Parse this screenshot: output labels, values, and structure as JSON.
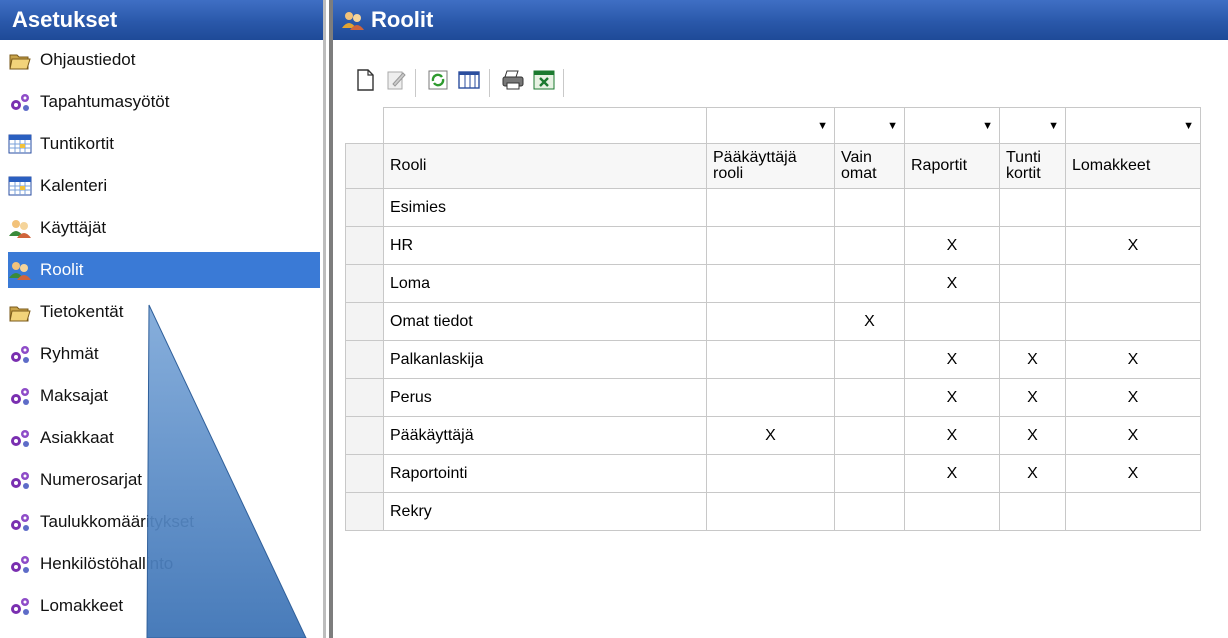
{
  "sidebar": {
    "title": "Asetukset",
    "items": [
      {
        "label": "Ohjaustiedot",
        "icon": "folder-icon"
      },
      {
        "label": "Tapahtumasyötöt",
        "icon": "gears-icon"
      },
      {
        "label": "Tuntikortit",
        "icon": "calendar-icon"
      },
      {
        "label": "Kalenteri",
        "icon": "calendar-icon"
      },
      {
        "label": "Käyttäjät",
        "icon": "users-icon"
      },
      {
        "label": "Roolit",
        "icon": "users-icon",
        "selected": true
      },
      {
        "label": "Tietokentät",
        "icon": "folder-icon"
      },
      {
        "label": "Ryhmät",
        "icon": "gears-icon"
      },
      {
        "label": "Maksajat",
        "icon": "gears-icon"
      },
      {
        "label": "Asiakkaat",
        "icon": "gears-icon"
      },
      {
        "label": "Numerosarjat",
        "icon": "gears-icon"
      },
      {
        "label": "Taulukkomääritykset",
        "icon": "gears-icon"
      },
      {
        "label": "Henkilöstöhallinto",
        "icon": "gears-icon"
      },
      {
        "label": "Lomakkeet",
        "icon": "gears-icon"
      }
    ]
  },
  "main": {
    "title": "Roolit",
    "toolbar": [
      "new-document-icon",
      "edit-icon",
      "refresh-icon",
      "columns-icon",
      "print-icon",
      "excel-export-icon"
    ],
    "columns": [
      "Rooli",
      "Pääkäyttäjä rooli",
      "Vain omat",
      "Raportit",
      "Tunti kortit",
      "Lomakkeet"
    ],
    "rows": [
      [
        "Esimies",
        "",
        "",
        "",
        "",
        ""
      ],
      [
        "HR",
        "",
        "",
        "X",
        "",
        "X"
      ],
      [
        "Loma",
        "",
        "",
        "X",
        "",
        ""
      ],
      [
        "Omat tiedot",
        "",
        "X",
        "",
        "",
        ""
      ],
      [
        "Palkanlaskija",
        "",
        "",
        "X",
        "X",
        "X"
      ],
      [
        "Perus",
        "",
        "",
        "X",
        "X",
        "X"
      ],
      [
        "Pääkäyttäjä",
        "X",
        "",
        "X",
        "X",
        "X"
      ],
      [
        "Raportointi",
        "",
        "",
        "X",
        "X",
        "X"
      ],
      [
        "Rekry",
        "",
        "",
        "",
        "",
        ""
      ]
    ]
  },
  "colors": {
    "header_blue": "#2a58aa",
    "selected_blue": "#3a7ad6",
    "callout_blue": "#4a80c0"
  }
}
